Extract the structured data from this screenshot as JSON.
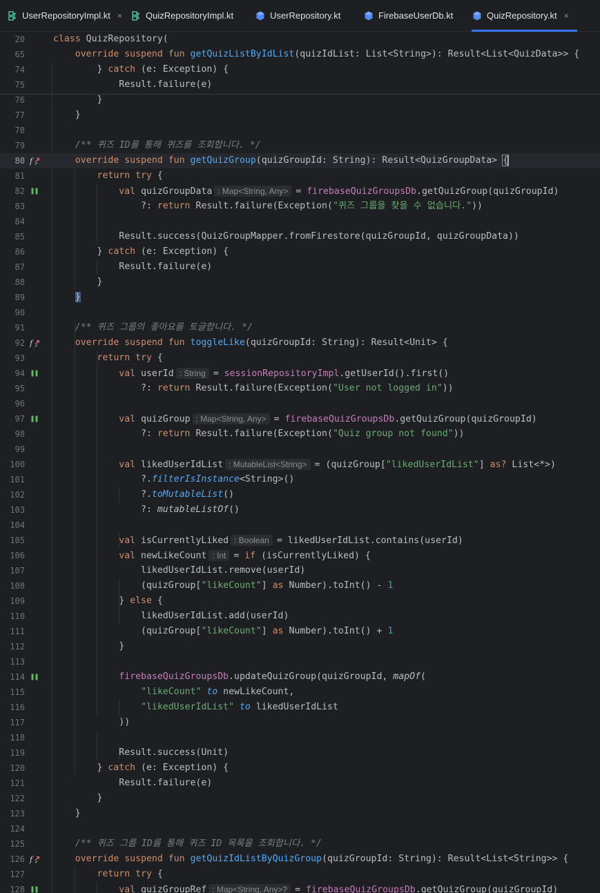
{
  "tabs": [
    {
      "label": "UserRepositoryImpl.kt",
      "icon": "kotlin-class-icon",
      "closable": true,
      "active": false
    },
    {
      "label": "QuizRepositoryImpl.kt",
      "icon": "kotlin-class-icon",
      "closable": false,
      "active": false
    },
    {
      "label": "UserRepository.kt",
      "icon": "kotlin-interface-icon",
      "closable": false,
      "active": false
    },
    {
      "label": "FirebaseUserDb.kt",
      "icon": "kotlin-interface-icon",
      "closable": false,
      "active": false
    },
    {
      "label": "QuizRepository.kt",
      "icon": "kotlin-interface-icon",
      "closable": true,
      "active": true
    }
  ],
  "close_glyph": "×",
  "colors": {
    "keyword": "#cf8e6d",
    "function": "#56a8f5",
    "property": "#c77dbb",
    "string": "#6aab73",
    "number": "#2aacb8",
    "comment": "#7a7e85",
    "accent": "#3574f0"
  },
  "current_line": 80,
  "lines": [
    {
      "n": 20,
      "g": "",
      "t": [
        [
          "kw",
          "class "
        ],
        [
          "",
          "QuizRepository("
        ]
      ]
    },
    {
      "n": 65,
      "g": "",
      "t": [
        [
          "",
          "    "
        ],
        [
          "kw",
          "override suspend fun "
        ],
        [
          "fn",
          "getQuizListByIdList"
        ],
        [
          "",
          "(quizIdList: List<String>): Result<List<QuizData>> {"
        ]
      ]
    },
    {
      "n": 74,
      "g": "",
      "t": [
        [
          "",
          "        } "
        ],
        [
          "kw",
          "catch "
        ],
        [
          "",
          "(e: Exception) {"
        ]
      ]
    },
    {
      "n": 75,
      "g": "",
      "t": [
        [
          "",
          "            Result.failure(e)"
        ]
      ]
    },
    {
      "n": 76,
      "g": "",
      "t": [
        [
          "",
          "        }"
        ]
      ]
    },
    {
      "n": 77,
      "g": "",
      "t": [
        [
          "",
          "    }"
        ]
      ]
    },
    {
      "n": 78,
      "g": "",
      "t": []
    },
    {
      "n": 79,
      "g": "",
      "t": [
        [
          "",
          "    "
        ],
        [
          "cmt",
          "/** 퀴즈 ID를 통해 퀴즈를 조회합니다. */"
        ]
      ]
    },
    {
      "n": 80,
      "g": "override-icon",
      "t": [
        [
          "",
          "    "
        ],
        [
          "kw",
          "override suspend fun "
        ],
        [
          "fn",
          "getQuizGroup"
        ],
        [
          "",
          "(quizGroupId: String): Result<QuizGroupData> "
        ],
        [
          "bh",
          "{"
        ],
        [
          "caret",
          ""
        ]
      ]
    },
    {
      "n": 81,
      "g": "",
      "t": [
        [
          "",
          "        "
        ],
        [
          "kw",
          "return try "
        ],
        [
          "",
          "{"
        ]
      ]
    },
    {
      "n": 82,
      "g": "suspend-icon",
      "t": [
        [
          "",
          "            "
        ],
        [
          "kw",
          "val "
        ],
        [
          "",
          "quizGroupData"
        ],
        [
          "hint",
          ": Map<String, Any>"
        ],
        [
          "",
          "= "
        ],
        [
          "prop",
          "firebaseQuizGroupsDb"
        ],
        [
          "",
          ".getQuizGroup(quizGroupId)"
        ]
      ]
    },
    {
      "n": 83,
      "g": "",
      "t": [
        [
          "",
          "                ?: "
        ],
        [
          "kw",
          "return "
        ],
        [
          "",
          "Result.failure(Exception("
        ],
        [
          "str",
          "\"퀴즈 그룹을 찾을 수 없습니다.\""
        ],
        [
          "",
          "))"
        ]
      ]
    },
    {
      "n": 84,
      "g": "",
      "t": []
    },
    {
      "n": 85,
      "g": "",
      "t": [
        [
          "",
          "            Result.success(QuizGroupMapper.fromFirestore(quizGroupId, quizGroupData))"
        ]
      ]
    },
    {
      "n": 86,
      "g": "",
      "t": [
        [
          "",
          "        } "
        ],
        [
          "kw",
          "catch "
        ],
        [
          "",
          "(e: Exception) {"
        ]
      ]
    },
    {
      "n": 87,
      "g": "",
      "t": [
        [
          "",
          "            Result.failure(e)"
        ]
      ]
    },
    {
      "n": 88,
      "g": "",
      "t": [
        [
          "",
          "        }"
        ]
      ]
    },
    {
      "n": 89,
      "g": "",
      "t": [
        [
          "",
          "    "
        ],
        [
          "bh2",
          "}"
        ]
      ]
    },
    {
      "n": 90,
      "g": "",
      "t": []
    },
    {
      "n": 91,
      "g": "",
      "t": [
        [
          "",
          "    "
        ],
        [
          "cmt",
          "/** 퀴즈 그룹의 좋아요를 토글합니다. */"
        ]
      ]
    },
    {
      "n": 92,
      "g": "override-icon",
      "t": [
        [
          "",
          "    "
        ],
        [
          "kw",
          "override suspend fun "
        ],
        [
          "fn",
          "toggleLike"
        ],
        [
          "",
          "(quizGroupId: String): Result<Unit> {"
        ]
      ]
    },
    {
      "n": 93,
      "g": "",
      "t": [
        [
          "",
          "        "
        ],
        [
          "kw",
          "return try "
        ],
        [
          "",
          "{"
        ]
      ]
    },
    {
      "n": 94,
      "g": "suspend-icon",
      "t": [
        [
          "",
          "            "
        ],
        [
          "kw",
          "val "
        ],
        [
          "",
          "userId"
        ],
        [
          "hint",
          ": String"
        ],
        [
          "",
          "= "
        ],
        [
          "prop",
          "sessionRepositoryImpl"
        ],
        [
          "",
          ".getUserId().first()"
        ]
      ]
    },
    {
      "n": 95,
      "g": "",
      "t": [
        [
          "",
          "                ?: "
        ],
        [
          "kw",
          "return "
        ],
        [
          "",
          "Result.failure(Exception("
        ],
        [
          "str",
          "\"User not logged in\""
        ],
        [
          "",
          "))"
        ]
      ]
    },
    {
      "n": 96,
      "g": "",
      "t": []
    },
    {
      "n": 97,
      "g": "suspend-icon",
      "t": [
        [
          "",
          "            "
        ],
        [
          "kw",
          "val "
        ],
        [
          "",
          "quizGroup"
        ],
        [
          "hint",
          ": Map<String, Any>"
        ],
        [
          "",
          "= "
        ],
        [
          "prop",
          "firebaseQuizGroupsDb"
        ],
        [
          "",
          ".getQuizGroup(quizGroupId)"
        ]
      ]
    },
    {
      "n": 98,
      "g": "",
      "t": [
        [
          "",
          "                ?: "
        ],
        [
          "kw",
          "return "
        ],
        [
          "",
          "Result.failure(Exception("
        ],
        [
          "str",
          "\"Quiz group not found\""
        ],
        [
          "",
          "))"
        ]
      ]
    },
    {
      "n": 99,
      "g": "",
      "t": []
    },
    {
      "n": 100,
      "g": "",
      "t": [
        [
          "",
          "            "
        ],
        [
          "kw",
          "val "
        ],
        [
          "",
          "likedUserIdList"
        ],
        [
          "hint",
          ": MutableList<String>"
        ],
        [
          "",
          "= (quizGroup["
        ],
        [
          "str",
          "\"likedUserIdList\""
        ],
        [
          "",
          "] "
        ],
        [
          "kw",
          "as? "
        ],
        [
          "",
          "List<*>)"
        ]
      ]
    },
    {
      "n": 101,
      "g": "",
      "t": [
        [
          "",
          "                ?."
        ],
        [
          "ext",
          "filterIsInstance"
        ],
        [
          "",
          "<String>()"
        ]
      ]
    },
    {
      "n": 102,
      "g": "",
      "t": [
        [
          "",
          "                ?."
        ],
        [
          "ext",
          "toMutableList"
        ],
        [
          "",
          "()"
        ]
      ]
    },
    {
      "n": 103,
      "g": "",
      "t": [
        [
          "",
          "                ?: "
        ],
        [
          "it",
          "mutableListOf"
        ],
        [
          "",
          "()"
        ]
      ]
    },
    {
      "n": 104,
      "g": "",
      "t": []
    },
    {
      "n": 105,
      "g": "",
      "t": [
        [
          "",
          "            "
        ],
        [
          "kw",
          "val "
        ],
        [
          "",
          "isCurrentlyLiked"
        ],
        [
          "hint",
          ": Boolean"
        ],
        [
          "",
          "= likedUserIdList.contains(userId)"
        ]
      ]
    },
    {
      "n": 106,
      "g": "",
      "t": [
        [
          "",
          "            "
        ],
        [
          "kw",
          "val "
        ],
        [
          "",
          "newLikeCount"
        ],
        [
          "hint",
          ": Int"
        ],
        [
          "",
          "= "
        ],
        [
          "kw",
          "if "
        ],
        [
          "",
          "(isCurrentlyLiked) {"
        ]
      ]
    },
    {
      "n": 107,
      "g": "",
      "t": [
        [
          "",
          "                likedUserIdList.remove(userId)"
        ]
      ]
    },
    {
      "n": 108,
      "g": "",
      "t": [
        [
          "",
          "                (quizGroup["
        ],
        [
          "str",
          "\"likeCount\""
        ],
        [
          "",
          "] "
        ],
        [
          "kw",
          "as "
        ],
        [
          "",
          "Number).toInt() - "
        ],
        [
          "num",
          "1"
        ]
      ]
    },
    {
      "n": 109,
      "g": "",
      "t": [
        [
          "",
          "            } "
        ],
        [
          "kw",
          "else "
        ],
        [
          "",
          "{"
        ]
      ]
    },
    {
      "n": 110,
      "g": "",
      "t": [
        [
          "",
          "                likedUserIdList.add(userId)"
        ]
      ]
    },
    {
      "n": 111,
      "g": "",
      "t": [
        [
          "",
          "                (quizGroup["
        ],
        [
          "str",
          "\"likeCount\""
        ],
        [
          "",
          "] "
        ],
        [
          "kw",
          "as "
        ],
        [
          "",
          "Number).toInt() + "
        ],
        [
          "num",
          "1"
        ]
      ]
    },
    {
      "n": 112,
      "g": "",
      "t": [
        [
          "",
          "            }"
        ]
      ]
    },
    {
      "n": 113,
      "g": "",
      "t": []
    },
    {
      "n": 114,
      "g": "suspend-icon",
      "t": [
        [
          "",
          "            "
        ],
        [
          "prop",
          "firebaseQuizGroupsDb"
        ],
        [
          "",
          ".updateQuizGroup(quizGroupId, "
        ],
        [
          "it",
          "mapOf"
        ],
        [
          "",
          "("
        ]
      ]
    },
    {
      "n": 115,
      "g": "",
      "t": [
        [
          "",
          "                "
        ],
        [
          "str",
          "\"likeCount\" "
        ],
        [
          "ext",
          "to "
        ],
        [
          "",
          "newLikeCount,"
        ]
      ]
    },
    {
      "n": 116,
      "g": "",
      "t": [
        [
          "",
          "                "
        ],
        [
          "str",
          "\"likedUserIdList\" "
        ],
        [
          "ext",
          "to "
        ],
        [
          "",
          "likedUserIdList"
        ]
      ]
    },
    {
      "n": 117,
      "g": "",
      "t": [
        [
          "",
          "            ))"
        ]
      ]
    },
    {
      "n": 118,
      "g": "",
      "t": []
    },
    {
      "n": 119,
      "g": "",
      "t": [
        [
          "",
          "            Result.success(Unit)"
        ]
      ]
    },
    {
      "n": 120,
      "g": "",
      "t": [
        [
          "",
          "        } "
        ],
        [
          "kw",
          "catch "
        ],
        [
          "",
          "(e: Exception) {"
        ]
      ]
    },
    {
      "n": 121,
      "g": "",
      "t": [
        [
          "",
          "            Result.failure(e)"
        ]
      ]
    },
    {
      "n": 122,
      "g": "",
      "t": [
        [
          "",
          "        }"
        ]
      ]
    },
    {
      "n": 123,
      "g": "",
      "t": [
        [
          "",
          "    }"
        ]
      ]
    },
    {
      "n": 124,
      "g": "",
      "t": []
    },
    {
      "n": 125,
      "g": "",
      "t": [
        [
          "",
          "    "
        ],
        [
          "cmt",
          "/** 퀴즈 그룹 ID를 통해 퀴즈 ID 목록을 조회합니다. */"
        ]
      ]
    },
    {
      "n": 126,
      "g": "override-icon",
      "t": [
        [
          "",
          "    "
        ],
        [
          "kw",
          "override suspend fun "
        ],
        [
          "fn",
          "getQuizIdListByQuizGroup"
        ],
        [
          "",
          "(quizGroupId: String): Result<List<String>> {"
        ]
      ]
    },
    {
      "n": 127,
      "g": "",
      "t": [
        [
          "",
          "        "
        ],
        [
          "kw",
          "return try "
        ],
        [
          "",
          "{"
        ]
      ]
    },
    {
      "n": 128,
      "g": "suspend-icon",
      "t": [
        [
          "",
          "            "
        ],
        [
          "kw",
          "val "
        ],
        [
          "",
          "quizGroupRef"
        ],
        [
          "hint",
          ": Map<String, Any>?"
        ],
        [
          "",
          "= "
        ],
        [
          "prop",
          "firebaseQuizGroupsDb"
        ],
        [
          "",
          ".getQuizGroup(quizGroupId)"
        ]
      ]
    }
  ]
}
